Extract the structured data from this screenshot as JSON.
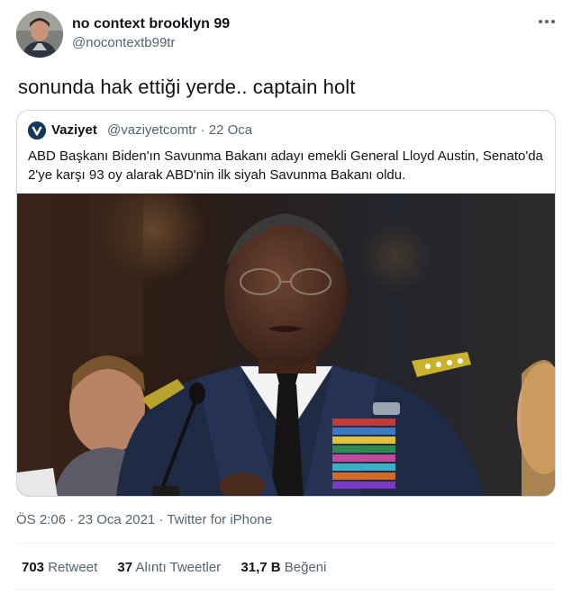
{
  "author": {
    "display_name": "no context brooklyn 99",
    "handle": "@nocontextb99tr",
    "avatar_icon": "user-avatar"
  },
  "tweet": {
    "text": "sonunda hak ettiği yerde.. captain holt",
    "timestamp": "ÖS 2:06 · 23 Oca 2021 · Twitter for iPhone"
  },
  "quoted": {
    "display_name": "Vaziyet",
    "handle": "@vaziyetcomtr · 22 Oca",
    "text": "ABD Başkanı Biden'ın Savunma Bakanı adayı emekli General Lloyd Austin, Senato'da 2'ye karşı 93 oy alarak ABD'nin ilk siyah Savunma Bakanı oldu.",
    "logo_icon": "checkmark-v-logo"
  },
  "stats": {
    "retweets_count": "703",
    "retweets_label": "Retweet",
    "quotes_count": "37",
    "quotes_label": "Alıntı Tweetler",
    "likes_count": "31,7 B",
    "likes_label": "Beğeni"
  },
  "colors": {
    "primary_text": "#0f1419",
    "secondary_text": "#536471",
    "border": "#cfd9de",
    "uniform": "#1f2a44"
  }
}
